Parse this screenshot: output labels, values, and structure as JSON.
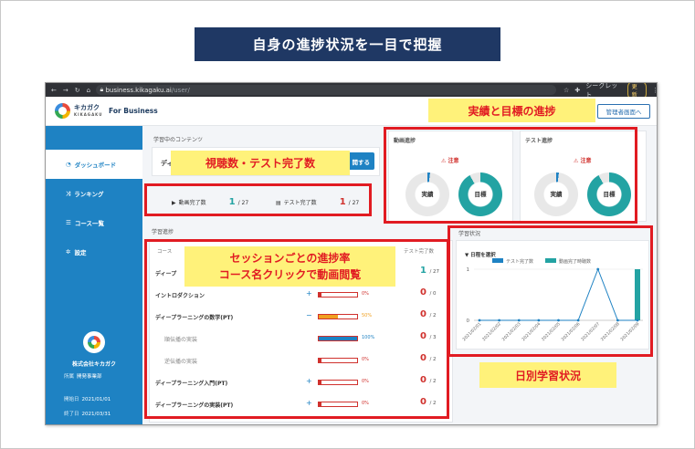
{
  "slide_title": "自身の進捗状況を一目で把握",
  "browser": {
    "url_host": "business.kikagaku.ai",
    "url_path": "/user/",
    "profile": "シークレット",
    "update_label": "更新"
  },
  "header": {
    "brand": "キカガク",
    "brand_sub": "KIKAGAKU",
    "product": "For Business",
    "admin_button": "管理者画面へ"
  },
  "sidebar": {
    "items": [
      {
        "icon": "◔",
        "label": "ダッシュボード",
        "active": true
      },
      {
        "icon": "⤨",
        "label": "ランキング"
      },
      {
        "icon": "☰",
        "label": "コース一覧"
      },
      {
        "icon": "✲",
        "label": "設定"
      }
    ],
    "org_name": "株式会社キカガク",
    "department_label": "所属",
    "department": "開発事業部",
    "start_label": "開始日",
    "start_date": "2021/01/01",
    "end_label": "終了日",
    "end_date": "2021/03/31"
  },
  "learning": {
    "label": "学習中のコンテンツ",
    "course_prefix": "ディ",
    "action_button": "開する",
    "video_label": "動画完了数",
    "video_done": "1",
    "video_total": "/ 27",
    "test_label": "テスト完了数",
    "test_done": "1",
    "test_total": "/ 27"
  },
  "progress": {
    "label": "学習進捗",
    "col_course": "コース",
    "col_test": "テスト完了数",
    "top_course_prefix": "ディープ",
    "top_score": "1",
    "top_total": "/ 27",
    "rows": [
      {
        "name": "イントロダクション",
        "toggle": "+",
        "pct": "0%",
        "fill": 0.08,
        "color": "#d0312d",
        "done": "0",
        "total": "/ 0"
      },
      {
        "name": "ディープラーニングの数学(PT)",
        "toggle": "−",
        "pct": "50%",
        "fill": 0.5,
        "color": "#f0a020",
        "done": "0",
        "total": "/ 2"
      },
      {
        "name": "順伝播の実装",
        "sub": true,
        "toggle": "",
        "pct": "100%",
        "fill": 1.0,
        "color": "#1e82c3",
        "done": "0",
        "total": "/ 3"
      },
      {
        "name": "逆伝播の実装",
        "sub": true,
        "toggle": "",
        "pct": "0%",
        "fill": 0.08,
        "color": "#d0312d",
        "done": "0",
        "total": "/ 2"
      },
      {
        "name": "ディープラーニング入門(PT)",
        "toggle": "+",
        "pct": "0%",
        "fill": 0.08,
        "color": "#d0312d",
        "done": "0",
        "total": "/ 2"
      },
      {
        "name": "ディープラーニングの実装(PT)",
        "toggle": "+",
        "pct": "0%",
        "fill": 0.08,
        "color": "#d0312d",
        "done": "0",
        "total": "/ 2"
      }
    ]
  },
  "donuts": {
    "video_title": "動画進捗",
    "test_title": "テスト進捗",
    "warning": "注意",
    "actual_label": "実績",
    "goal_label": "目標",
    "video_actual_fraction": 0.02,
    "test_actual_fraction": 0.02,
    "goal_fraction": 0.92
  },
  "chart_data": {
    "type": "line",
    "title": "学習状況",
    "selector_label": "▼ 日程を選択",
    "x": [
      "2021/02/01",
      "2021/02/02",
      "2021/02/03",
      "2021/02/04",
      "2021/02/05",
      "2021/02/06",
      "2021/02/07",
      "2021/02/08",
      "2021/02/09"
    ],
    "ylim": [
      0,
      1
    ],
    "yticks": [
      "0",
      "1"
    ],
    "series": [
      {
        "name": "テスト完了数",
        "type": "line",
        "color": "#1e82c3",
        "values": [
          0,
          0,
          0,
          0,
          0,
          0,
          1,
          0,
          0
        ]
      },
      {
        "name": "動画完了時聴数",
        "type": "bar",
        "color": "#23a3a3",
        "values": [
          0,
          0,
          0,
          0,
          0,
          0,
          0,
          0,
          1
        ]
      }
    ]
  },
  "callouts": {
    "goal_progress": "実績と目標の進捗",
    "view_counts": "視聴数・テスト完了数",
    "session_line1": "セッションごとの進捗率",
    "session_line2": "コース名クリックで動画閲覧",
    "daily": "日別学習状況"
  },
  "colors": {
    "primary": "#1e82c3",
    "teal": "#23a3a3",
    "highlight": "#e11b22",
    "callout_bg": "#fff27a",
    "title_bg": "#1f3864"
  }
}
